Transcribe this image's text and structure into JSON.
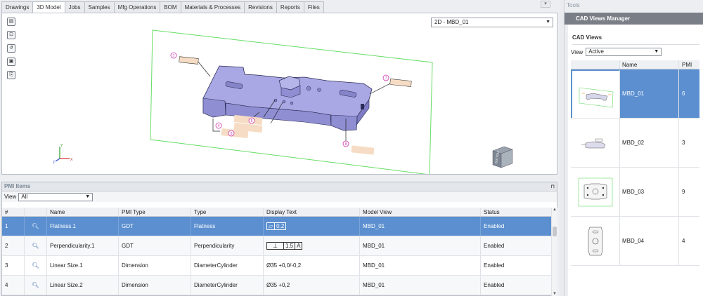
{
  "tabs": [
    {
      "label": "Drawings"
    },
    {
      "label": "3D Model"
    },
    {
      "label": "Jobs"
    },
    {
      "label": "Samples"
    },
    {
      "label": "Mfg Operations"
    },
    {
      "label": "BOM"
    },
    {
      "label": "Materials & Processes"
    },
    {
      "label": "Revisions"
    },
    {
      "label": "Reports"
    },
    {
      "label": "Files"
    }
  ],
  "active_tab": "3D Model",
  "viewport": {
    "view_select": "2D - MBD_01",
    "toolbar_icons": [
      "layers-icon",
      "zoom-fit-icon",
      "reset-view-icon",
      "save-icon",
      "export-icon"
    ],
    "balloons": [
      "7",
      "7",
      "5",
      "6",
      "4",
      "8"
    ],
    "axis_labels": {
      "x": "X",
      "y": "Y",
      "z": "Z"
    },
    "cube_label": "BOTTOM"
  },
  "pmi": {
    "title": "PMI Items",
    "view_label": "View",
    "view_value": "All",
    "columns": [
      "#",
      "",
      "Name",
      "PMI Type",
      "Type",
      "Display Text",
      "Model View",
      "Status"
    ],
    "rows": [
      {
        "num": "1",
        "name": "Flatness.1",
        "pmi_type": "GDT",
        "type": "Flatness",
        "display": [
          "▱",
          "0.2"
        ],
        "model_view": "MBD_01",
        "status": "Enabled"
      },
      {
        "num": "2",
        "name": "Perpendicularity.1",
        "pmi_type": "GDT",
        "type": "Perpendicularity",
        "display": [
          "⊥",
          "1.5",
          "A"
        ],
        "model_view": "MBD_01",
        "status": "Enabled"
      },
      {
        "num": "3",
        "name": "Linear Size.1",
        "pmi_type": "Dimension",
        "type": "DiameterCylinder",
        "display_text": "Ø35  +0,0/-0,2",
        "model_view": "MBD_01",
        "status": "Enabled"
      },
      {
        "num": "4",
        "name": "Linear Size.2",
        "pmi_type": "Dimension",
        "type": "DiameterCylinder",
        "display_text": "Ø35  +0,2",
        "model_view": "MBD_01",
        "status": "Enabled"
      }
    ]
  },
  "tools": {
    "title": "Tools",
    "manager_title": "CAD Views Manager",
    "section_title": "CAD Views",
    "view_label": "View",
    "view_value": "Active",
    "columns": [
      "",
      "Name",
      "PMI"
    ],
    "views": [
      {
        "name": "MBD_01",
        "pmi": "6"
      },
      {
        "name": "MBD_02",
        "pmi": "3"
      },
      {
        "name": "MBD_03",
        "pmi": "9"
      },
      {
        "name": "MBD_04",
        "pmi": "4"
      }
    ]
  },
  "colors": {
    "selection": "#5b8fd0",
    "model_fill": "#a9a8e4",
    "model_edge": "#2b2b55",
    "frame_green": "#66dd66",
    "balloon": "#cc33aa",
    "annotation_fill": "#f6dcc4"
  }
}
